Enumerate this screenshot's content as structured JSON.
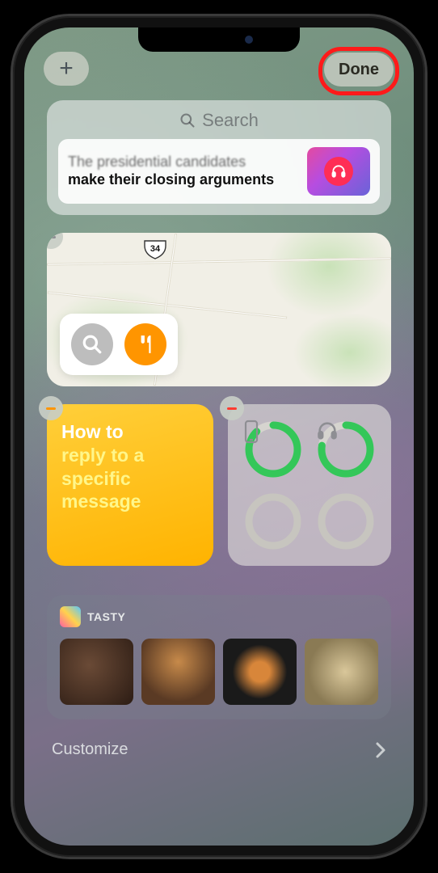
{
  "topbar": {
    "add_label": "+",
    "done_label": "Done"
  },
  "search": {
    "placeholder": "Search"
  },
  "news": {
    "line1": "The presidential candidates",
    "line2": "make their closing arguments"
  },
  "maps": {
    "route_number": "34",
    "minus_color": "#8e8e93"
  },
  "notes": {
    "line1": "How to",
    "line2": "reply to a",
    "line3": "specific",
    "line4": "message",
    "minus_color": "#ff9500"
  },
  "batteries": {
    "minus_color": "#ff3b30",
    "items": [
      {
        "icon": "phone",
        "progress": 0.88,
        "color": "#34c759"
      },
      {
        "icon": "headphones",
        "progress": 0.78,
        "color": "#34c759"
      },
      {
        "icon": "",
        "progress": 0,
        "color": "#b3b1ab"
      },
      {
        "icon": "",
        "progress": 0,
        "color": "#b3b1ab"
      }
    ]
  },
  "tasty": {
    "title": "TASTY"
  },
  "footer": {
    "customize_label": "Customize"
  }
}
